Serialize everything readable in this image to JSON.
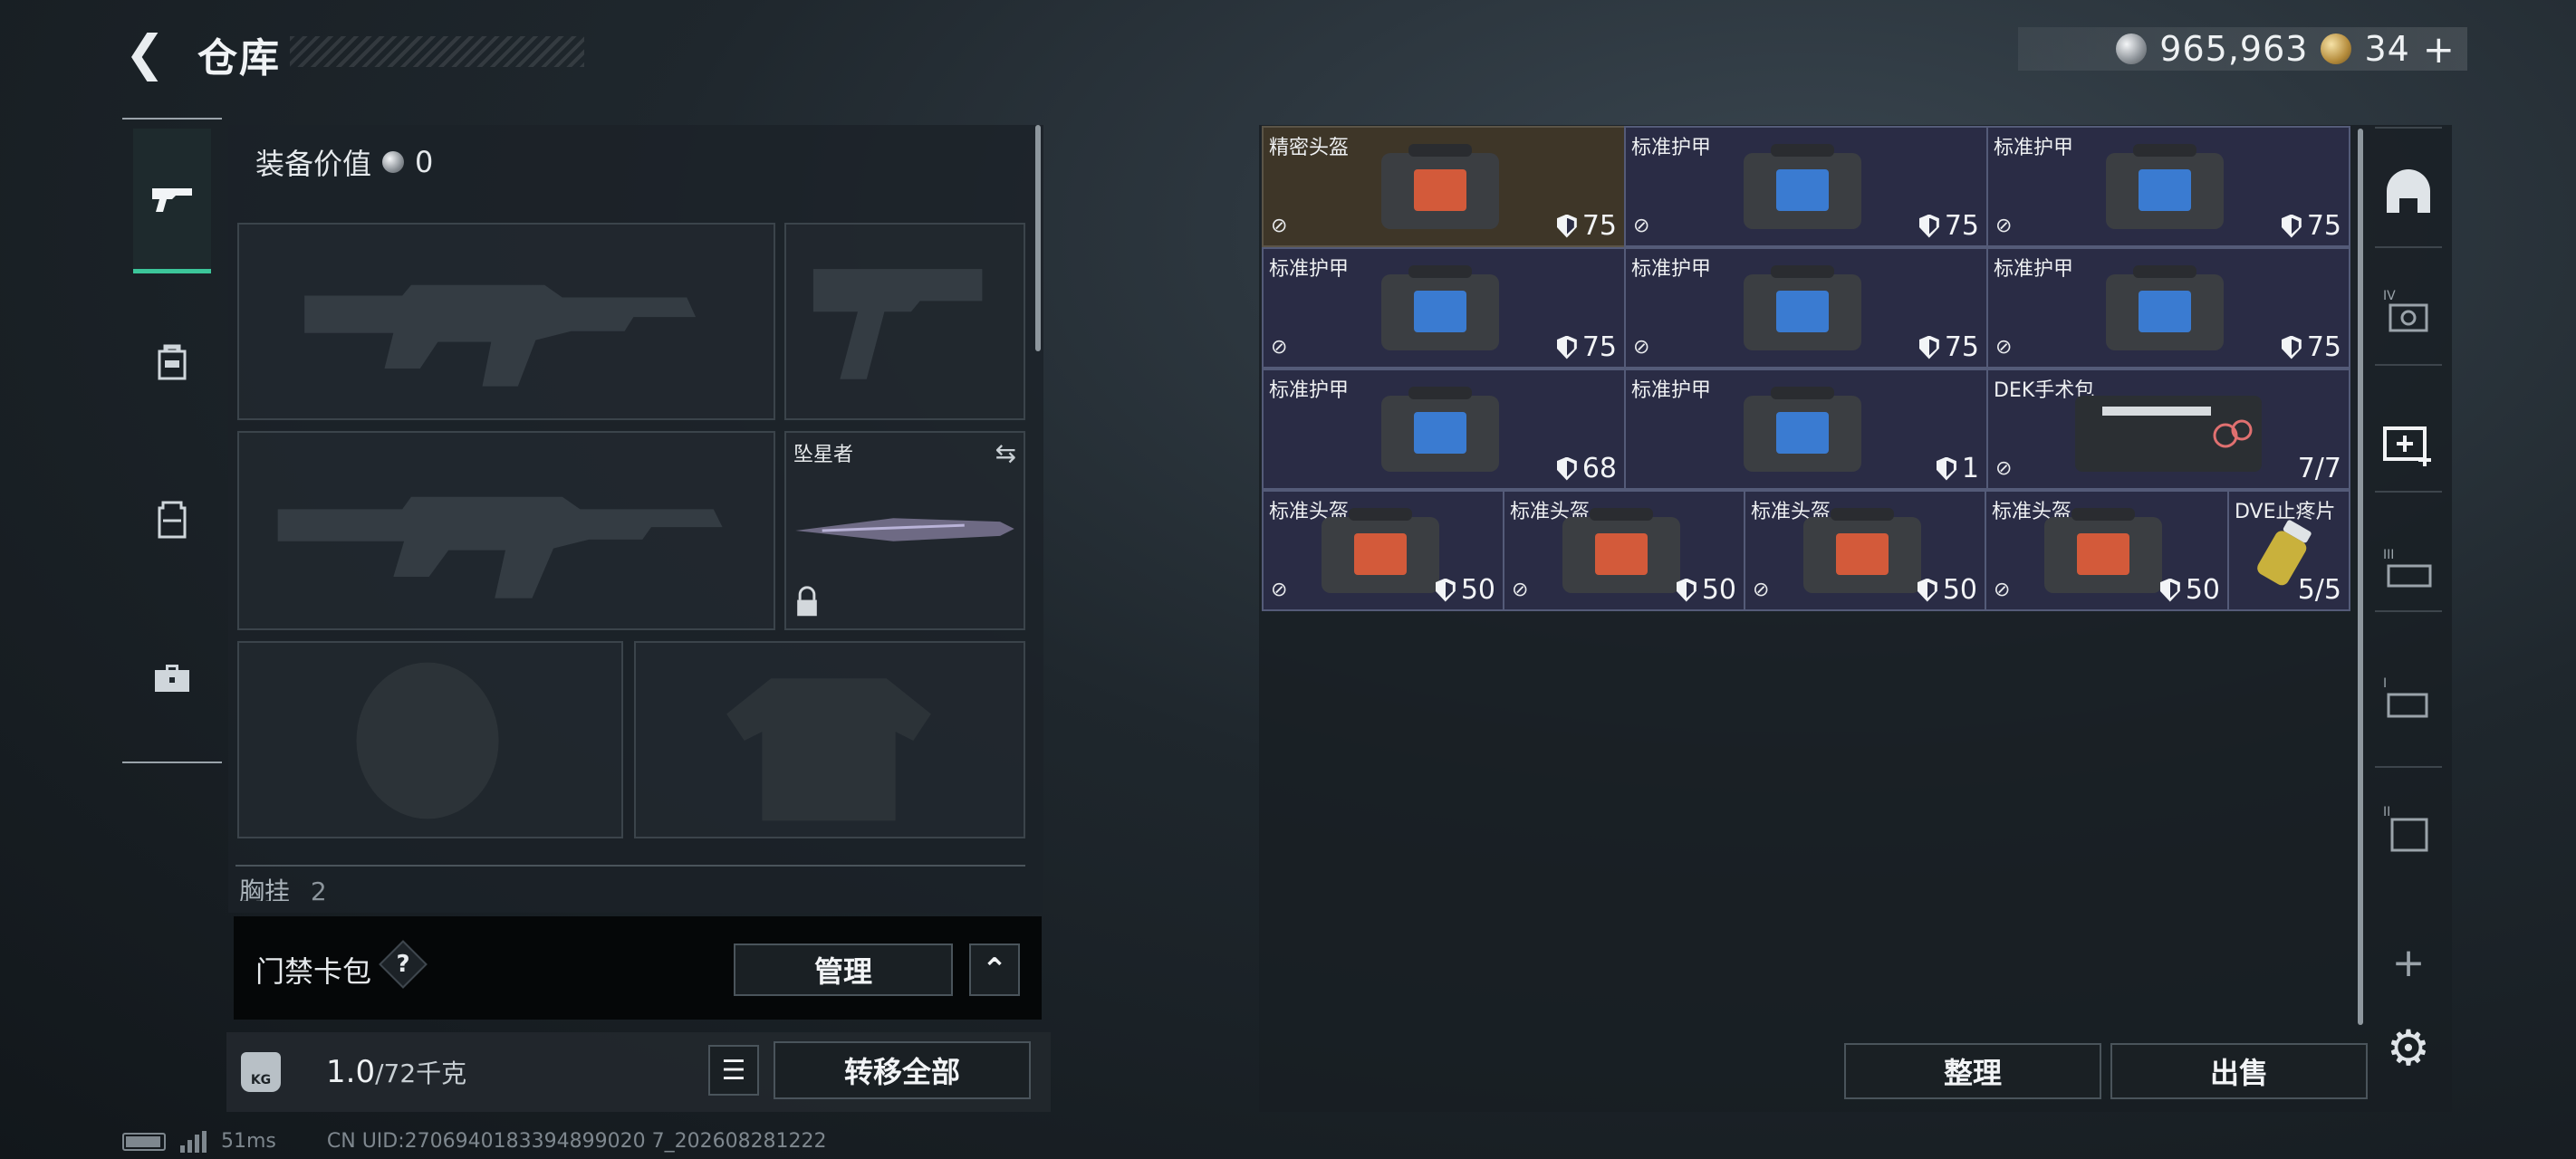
{
  "header": {
    "title": "仓库",
    "silver": "965,963",
    "gold": "34"
  },
  "equipment": {
    "value_label": "装备价值",
    "value": "0",
    "melee_name": "坠星者",
    "chest_label": "胸挂",
    "chest_count": "2"
  },
  "keycard": {
    "label": "门禁卡包",
    "help": "?",
    "manage": "管理"
  },
  "weight": {
    "kg_icon": "KG",
    "current": "1.0",
    "max": "/72千克",
    "transfer_all": "转移全部"
  },
  "status": {
    "ping": "51ms",
    "uid": "CN UID:2706940183394899020 7_202608281222"
  },
  "inventory": {
    "rows": [
      [
        {
          "name": "精密头盔",
          "value": "75"
        },
        {
          "name": "标准护甲",
          "value": "75"
        },
        {
          "name": "标准护甲",
          "value": "75"
        }
      ],
      [
        {
          "name": "标准护甲",
          "value": "75"
        },
        {
          "name": "标准护甲",
          "value": "75"
        },
        {
          "name": "标准护甲",
          "value": "75"
        }
      ],
      [
        {
          "name": "标准护甲",
          "value": "68"
        },
        {
          "name": "标准护甲",
          "value": "1"
        },
        {
          "name": "DEK手术包",
          "value": "7/7"
        }
      ],
      [
        {
          "name": "标准头盔",
          "value": "50"
        },
        {
          "name": "标准头盔",
          "value": "50"
        },
        {
          "name": "标准头盔",
          "value": "50"
        },
        {
          "name": "标准头盔",
          "value": "50"
        },
        {
          "name": "DVE止疼片",
          "value": "5/5"
        }
      ]
    ],
    "sort": "整理",
    "sell": "出售"
  },
  "side_tabs": [
    "helmet-rack-icon",
    "tier4-case-icon",
    "medkit-add-icon",
    "tier3-case-icon",
    "tier1-case-icon",
    "tier2-case-icon",
    "plus-icon",
    "settings-icon"
  ],
  "colors": {
    "accent": "#3cc69a",
    "cell_bg": "#2a2c45",
    "rare_cell_bg": "#3e3628"
  }
}
